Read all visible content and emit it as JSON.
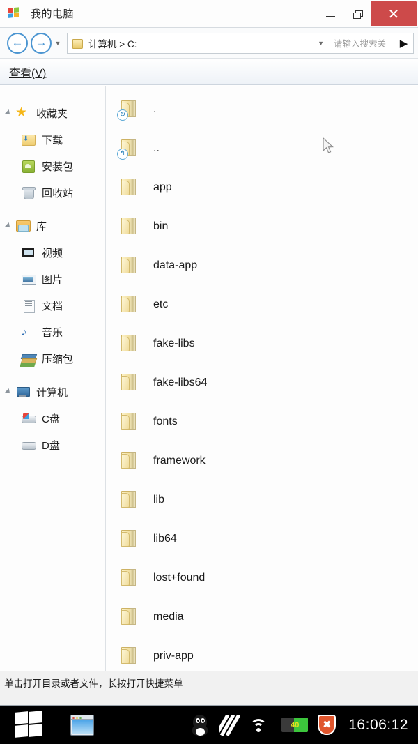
{
  "window": {
    "title": "我的电脑",
    "app_icon": "windows-flag-icon",
    "buttons": {
      "minimize": "–",
      "maximize": "❐",
      "close": "✕"
    }
  },
  "addressbar": {
    "back_icon": "←",
    "forward_icon": "→",
    "history_caret": "▼",
    "path": "计算机 > C:",
    "path_caret": "▼",
    "search_placeholder": "请输入搜索关",
    "search_value": "",
    "go_icon": "▶"
  },
  "menubar": {
    "items": [
      {
        "label": "查看(V)"
      }
    ]
  },
  "sidebar": {
    "groups": [
      {
        "label": "收藏夹",
        "icon": "star-icon",
        "expanded": true,
        "items": [
          {
            "label": "下载",
            "icon": "download-folder-icon"
          },
          {
            "label": "安装包",
            "icon": "apk-package-icon"
          },
          {
            "label": "回收站",
            "icon": "recycle-bin-icon"
          }
        ]
      },
      {
        "label": "库",
        "icon": "library-icon",
        "expanded": true,
        "items": [
          {
            "label": "视频",
            "icon": "video-icon"
          },
          {
            "label": "图片",
            "icon": "picture-icon"
          },
          {
            "label": "文档",
            "icon": "document-icon"
          },
          {
            "label": "音乐",
            "icon": "music-icon"
          },
          {
            "label": "压缩包",
            "icon": "archive-icon"
          }
        ]
      },
      {
        "label": "计算机",
        "icon": "computer-icon",
        "expanded": true,
        "items": [
          {
            "label": "C盘",
            "icon": "system-drive-icon"
          },
          {
            "label": "D盘",
            "icon": "drive-icon"
          }
        ]
      }
    ]
  },
  "filelist": {
    "rows": [
      {
        "name": ".",
        "icon": "folder-icon",
        "badge": "refresh-badge-icon",
        "badge_glyph": "↻"
      },
      {
        "name": "..",
        "icon": "folder-icon",
        "badge": "up-level-badge-icon",
        "badge_glyph": "↰"
      },
      {
        "name": "app",
        "icon": "folder-icon",
        "badge": null,
        "badge_glyph": ""
      },
      {
        "name": "bin",
        "icon": "folder-icon",
        "badge": null,
        "badge_glyph": ""
      },
      {
        "name": "data-app",
        "icon": "folder-icon",
        "badge": null,
        "badge_glyph": ""
      },
      {
        "name": "etc",
        "icon": "folder-icon",
        "badge": null,
        "badge_glyph": ""
      },
      {
        "name": "fake-libs",
        "icon": "folder-icon",
        "badge": null,
        "badge_glyph": ""
      },
      {
        "name": "fake-libs64",
        "icon": "folder-icon",
        "badge": null,
        "badge_glyph": ""
      },
      {
        "name": "fonts",
        "icon": "folder-icon",
        "badge": null,
        "badge_glyph": ""
      },
      {
        "name": "framework",
        "icon": "folder-icon",
        "badge": null,
        "badge_glyph": ""
      },
      {
        "name": "lib",
        "icon": "folder-icon",
        "badge": null,
        "badge_glyph": ""
      },
      {
        "name": "lib64",
        "icon": "folder-icon",
        "badge": null,
        "badge_glyph": ""
      },
      {
        "name": "lost+found",
        "icon": "folder-icon",
        "badge": null,
        "badge_glyph": ""
      },
      {
        "name": "media",
        "icon": "folder-icon",
        "badge": null,
        "badge_glyph": ""
      },
      {
        "name": "priv-app",
        "icon": "folder-icon",
        "badge": null,
        "badge_glyph": ""
      }
    ]
  },
  "statusbar": {
    "hint": "单击打开目录或者文件，长按打开快捷菜单"
  },
  "taskbar": {
    "start_icon": "windows-start-icon",
    "apps": [
      {
        "icon": "file-explorer-icon"
      }
    ],
    "tray": [
      {
        "icon": "qq-penguin-icon"
      },
      {
        "icon": "stripes-icon"
      },
      {
        "icon": "wifi-icon"
      },
      {
        "icon": "battery-icon",
        "level": "40"
      },
      {
        "icon": "security-shield-icon",
        "glyph": "✖"
      }
    ],
    "clock": "16:06:12"
  },
  "colors": {
    "close_button": "#cd4a4a",
    "accent_blue": "#4b95d1",
    "battery_green": "#3cc63c",
    "shield_orange": "#e0552c",
    "taskbar_bg": "#000000"
  }
}
